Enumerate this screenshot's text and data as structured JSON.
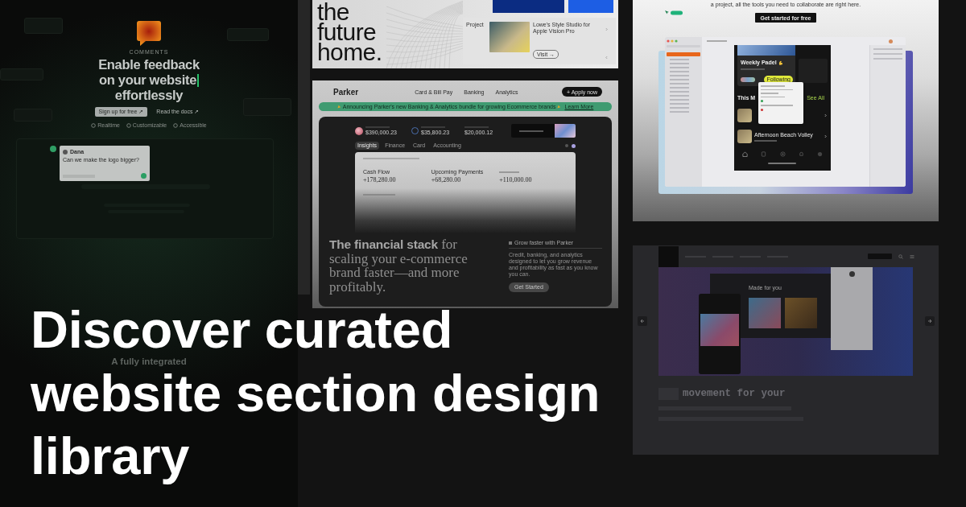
{
  "headline_lines": [
    "Discover curated",
    "website section design",
    "library"
  ],
  "comments_preview": {
    "eyebrow": "COMMENTS",
    "title_lines": [
      {
        "text": "Enable feedback",
        "cursor": false
      },
      {
        "text": "on your website",
        "cursor": true
      },
      {
        "text": "effortlessly",
        "cursor": false
      }
    ],
    "buttons": [
      {
        "label": "Sign up for free ↗",
        "kind": "primary"
      },
      {
        "label": "Read the docs ↗",
        "kind": "link"
      }
    ],
    "features": [
      "Realtime",
      "Customizable",
      "Accessible"
    ],
    "comment": {
      "author": "Dana",
      "message": "Can we make the logo bigger?"
    },
    "tagline": "A fully integrated"
  },
  "home_preview": {
    "title_lines": [
      "the",
      "future",
      "home."
    ],
    "project_label": "Project",
    "project_title": "Lowe's Style Studio for Apple Vision Pro",
    "button": "Visit →"
  },
  "parker_preview": {
    "brand": "Parker",
    "nav": [
      "Card & Bill Pay",
      "Banking",
      "Analytics"
    ],
    "cta": "+ Apply now",
    "banner": {
      "text": "Announcing Parker's new Banking & Analytics bundle for growing Ecommerce brands",
      "link": "Learn More"
    },
    "stats": [
      "$390,000.23",
      "$35,800.23",
      "$20,000.12"
    ],
    "tabs": [
      {
        "label": "Insights",
        "selected": true
      },
      {
        "label": "Finance",
        "selected": false
      },
      {
        "label": "Card",
        "selected": false
      },
      {
        "label": "Accounting",
        "selected": false
      }
    ],
    "metrics": [
      {
        "label": "Cash Flow",
        "value": "+178,280.00"
      },
      {
        "label": "Upcoming Payments",
        "value": "+68,280.00"
      },
      {
        "value": "+110,000.00"
      }
    ],
    "hero": "**The financial stack** for scaling your e-commerce brand faster—and more profitably.",
    "aside": {
      "title": "Grow faster with Parker",
      "text": "Credit, banking, and analytics designed to let you grow revenue and profitability as fast as you know you can.",
      "button": "Get Started"
    }
  },
  "collab_preview": {
    "intro": "a project, all the tools you need to collaborate are right here.",
    "cta": "Get started for free",
    "app": {
      "card_title": "Weekly Padel",
      "follow_button": "Following",
      "section_title": "This M",
      "see_all": "See All",
      "event_title": "Afternoon Beach Volley"
    }
  },
  "music_preview": {
    "section_title": "Made for you",
    "body": "movement for your"
  }
}
